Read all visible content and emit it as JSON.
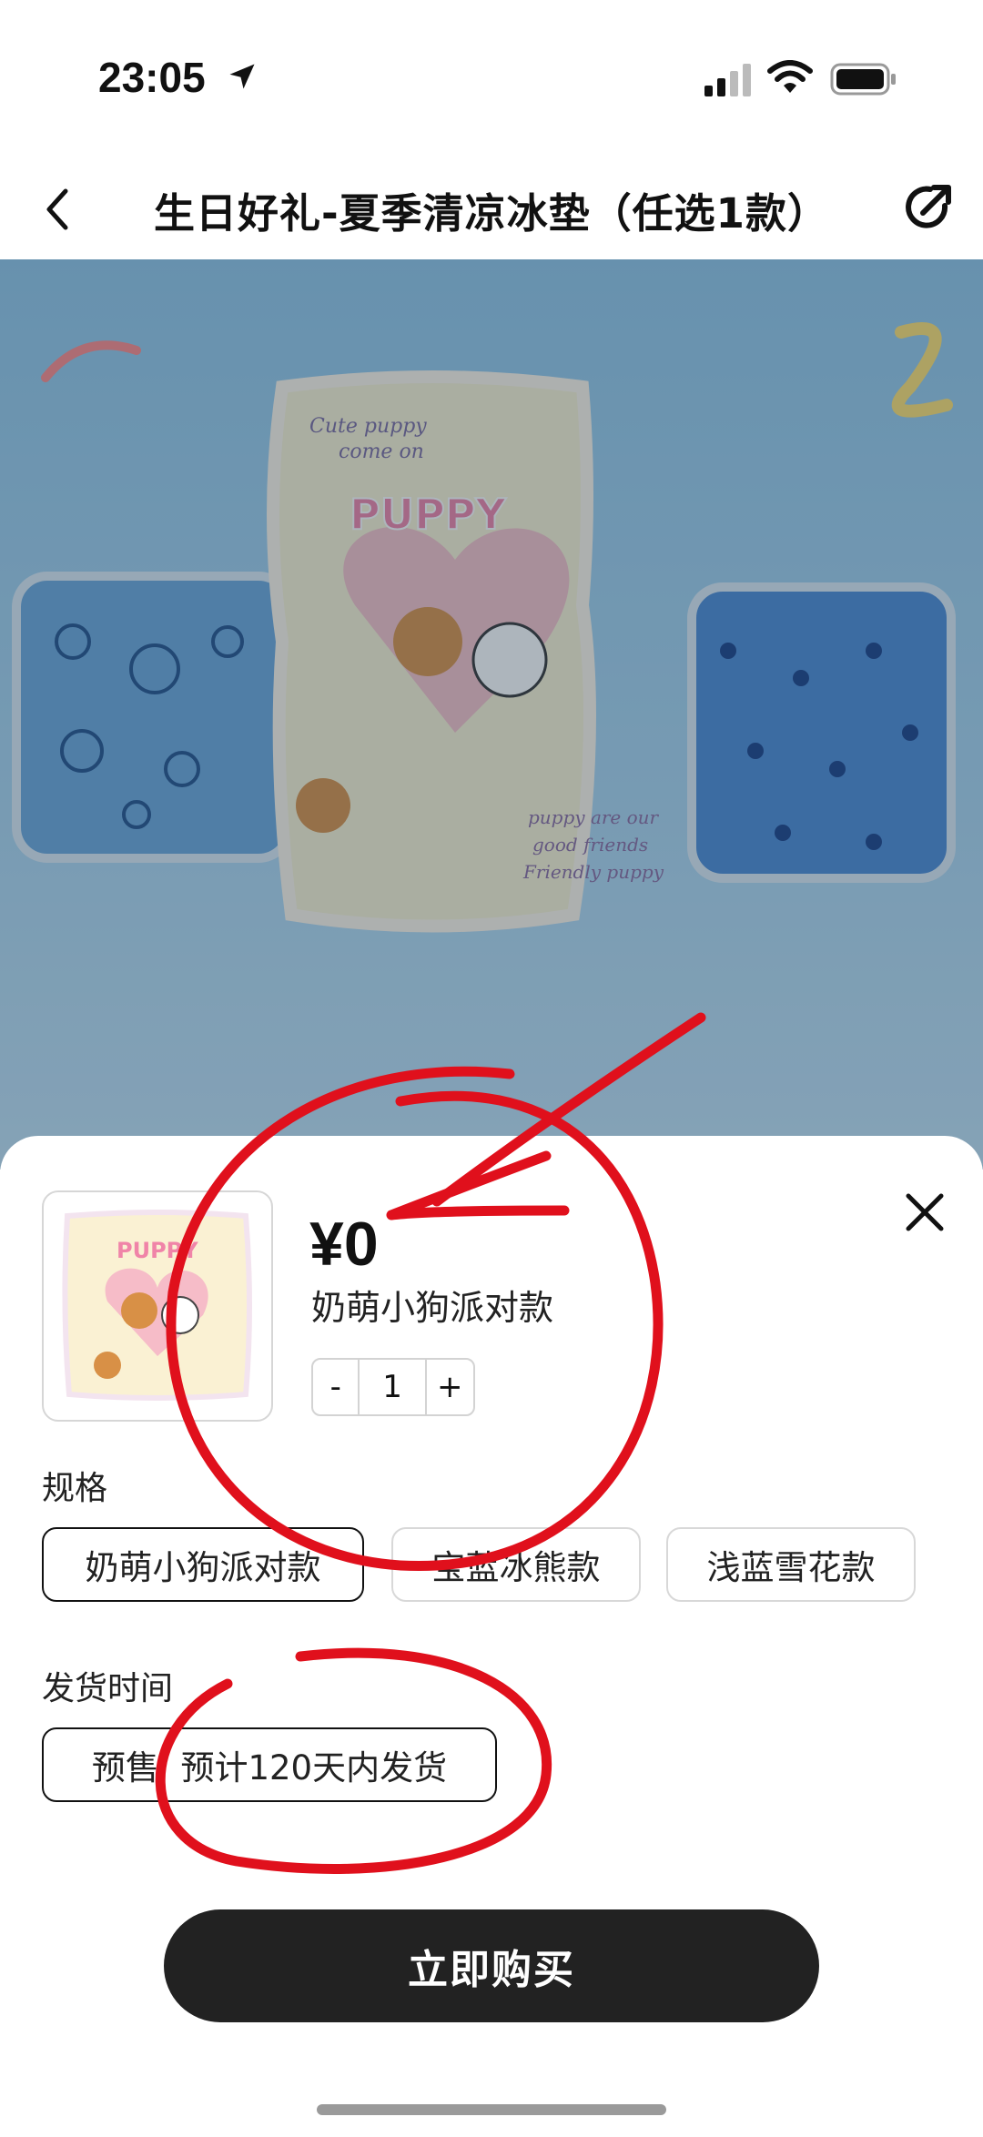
{
  "status_bar": {
    "time": "23:05"
  },
  "nav": {
    "title": "生日好礼-夏季清凉冰垫（任选1款）"
  },
  "hero": {
    "left_mat_icon": "snowflake-mat",
    "center_mat": {
      "text_top": "Cute puppy come on",
      "brand": "PUPPY",
      "text_bottom": "puppy are our good friends Friendly puppy"
    },
    "right_mat_icon": "polar-bear-mat"
  },
  "sheet": {
    "price": "¥0",
    "variant_name": "奶萌小狗派对款",
    "quantity": {
      "minus": "-",
      "value": "1",
      "plus": "+"
    },
    "spec_label": "规格",
    "spec_options": [
      {
        "label": "奶萌小狗派对款",
        "selected": true
      },
      {
        "label": "宝蓝冰熊款",
        "selected": false
      },
      {
        "label": "浅蓝雪花款",
        "selected": false
      }
    ],
    "ship_label": "发货时间",
    "ship_option": "预售  预计120天内发货",
    "buy_button": "立即购买"
  },
  "colors": {
    "button_bg": "#222222",
    "annotation_red": "#e0101c",
    "hero_blue": "#9ccdeb"
  }
}
